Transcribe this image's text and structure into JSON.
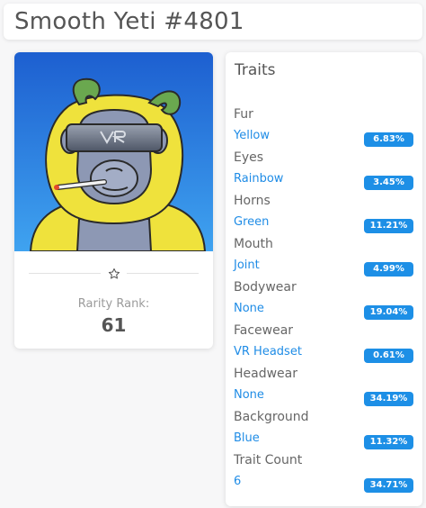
{
  "page": {
    "title": "Smooth Yeti #4801"
  },
  "nft": {
    "image_alt": "Smooth Yeti #4801",
    "rarity_label": "Rarity Rank:",
    "rarity_rank": "61",
    "favorite_icon": "star-outline-icon"
  },
  "traits": {
    "heading": "Traits",
    "items": [
      {
        "name": "Fur",
        "value": "Yellow",
        "pct": "6.83%"
      },
      {
        "name": "Eyes",
        "value": "Rainbow",
        "pct": "3.45%"
      },
      {
        "name": "Horns",
        "value": "Green",
        "pct": "11.21%"
      },
      {
        "name": "Mouth",
        "value": "Joint",
        "pct": "4.99%"
      },
      {
        "name": "Bodywear",
        "value": "None",
        "pct": "19.04%"
      },
      {
        "name": "Facewear",
        "value": "VR Headset",
        "pct": "0.61%"
      },
      {
        "name": "Headwear",
        "value": "None",
        "pct": "34.19%"
      },
      {
        "name": "Background",
        "value": "Blue",
        "pct": "11.32%"
      },
      {
        "name": "Trait Count",
        "value": "6",
        "pct": "34.71%"
      }
    ]
  },
  "colors": {
    "accent": "#1d8fe6",
    "link": "#1f8ce6",
    "background_blue": "#1e63c9"
  }
}
